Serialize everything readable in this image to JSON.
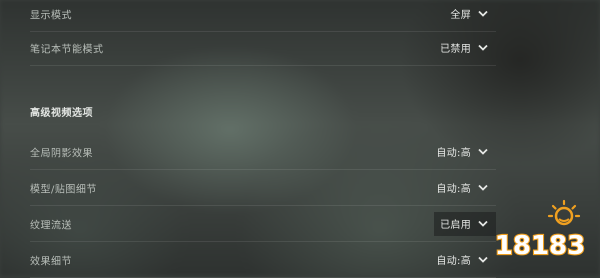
{
  "settings": {
    "rows": [
      {
        "label": "显示模式",
        "value": "全屏"
      },
      {
        "label": "笔记本节能模式",
        "value": "已禁用"
      }
    ],
    "advanced_section_title": "高级视频选项",
    "advanced_rows": [
      {
        "label": "全局阴影效果",
        "value": "自动:高"
      },
      {
        "label": "模型/贴图细节",
        "value": "自动:高"
      },
      {
        "label": "纹理流送",
        "value": "已启用"
      },
      {
        "label": "效果细节",
        "value": "自动:高"
      }
    ]
  },
  "watermark": {
    "text": "18183",
    "accent_color": "#f0a020",
    "text_color": "#ffffff"
  },
  "icons": {
    "dropdown": "chevron-down-icon"
  }
}
